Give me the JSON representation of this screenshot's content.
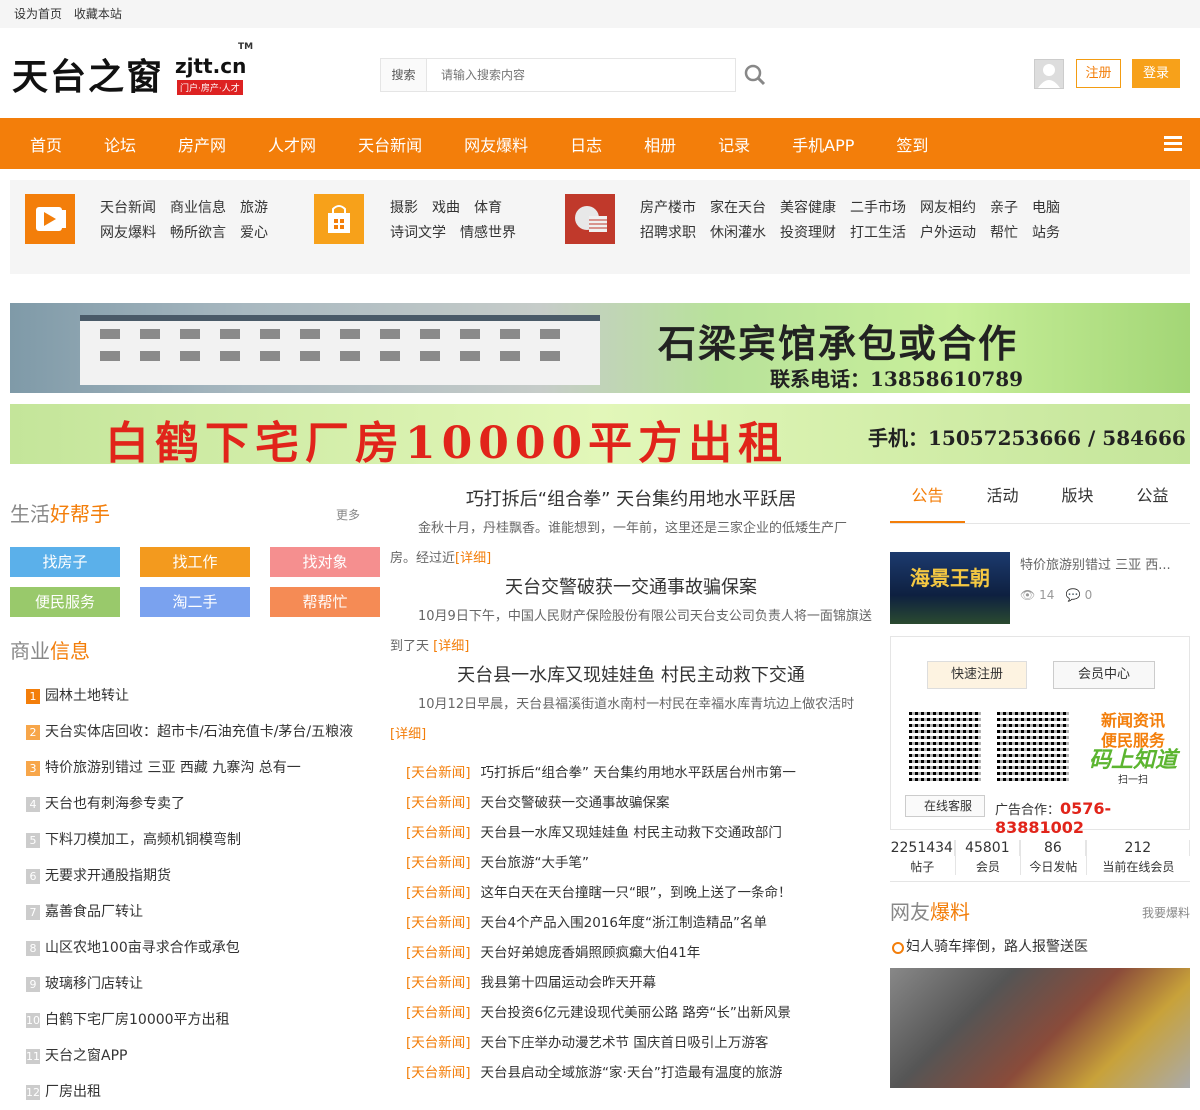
{
  "topbar": {
    "set_home": "设为首页",
    "favorite": "收藏本站"
  },
  "logo": {
    "cn": "天台之窗",
    "domain": "zjtt.cn",
    "tm": "TM",
    "sub": "门户·房产·人才"
  },
  "search": {
    "label": "搜索",
    "placeholder": "请输入搜索内容"
  },
  "auth": {
    "register": "注册",
    "login": "登录"
  },
  "nav": [
    "首页",
    "论坛",
    "房产网",
    "人才网",
    "天台新闻",
    "网友爆料",
    "日志",
    "相册",
    "记录",
    "手机APP",
    "签到"
  ],
  "cats": {
    "group1": {
      "row1": [
        "天台新闻",
        "商业信息",
        "旅游"
      ],
      "row2": [
        "网友爆料",
        "畅所欲言",
        "爱心"
      ]
    },
    "group2": {
      "row1": [
        "摄影",
        "戏曲",
        "体育"
      ],
      "row2": [
        "诗词文学",
        "情感世界"
      ]
    },
    "group3": {
      "row1": [
        "房产楼市",
        "家在天台",
        "美容健康",
        "二手市场",
        "网友相约",
        "亲子",
        "电脑"
      ],
      "row2": [
        "招聘求职",
        "休闲灌水",
        "投资理财",
        "打工生活",
        "户外运动",
        "帮忙",
        "站务"
      ]
    }
  },
  "banners": {
    "b1_title": "石梁宾馆承包或合作",
    "b1_phone": "联系电话：13858610789",
    "b2_title": "白鹤下宅厂房10000平方出租",
    "b2_phone": "手机：15057253666 / 584666"
  },
  "left": {
    "helper_title_a": "生活",
    "helper_title_b": "好帮手",
    "more": "更多",
    "helpers": [
      {
        "label": "找房子",
        "color": "#5bb0ea"
      },
      {
        "label": "找工作",
        "color": "#f39a1e"
      },
      {
        "label": "找对象",
        "color": "#f58f8f"
      },
      {
        "label": "便民服务",
        "color": "#99c96b"
      },
      {
        "label": "淘二手",
        "color": "#7aa2ef"
      },
      {
        "label": "帮帮忙",
        "color": "#f58b55"
      }
    ],
    "biz_title_a": "商业",
    "biz_title_b": "信息",
    "biz": [
      "园林土地转让",
      "天台实体店回收：超市卡/石油充值卡/茅台/五粮液",
      "特价旅游别错过 三亚 西藏 九寨沟 总有一",
      "天台也有刺海参专卖了",
      "下料刀模加工，高频机铜模弯制",
      "无要求开通股指期货",
      "嘉善食品厂转让",
      "山区农地100亩寻求合作或承包",
      "玻璃移门店转让",
      "白鹤下宅厂房10000平方出租",
      "天台之窗APP",
      "厂房出租"
    ],
    "biz_nums": [
      "1",
      "2",
      "3",
      "4",
      "5",
      "6",
      "7",
      "8",
      "9",
      "10",
      "11",
      "12"
    ]
  },
  "mid": {
    "stories": [
      {
        "title": "巧打拆后“组合拳” 天台集约用地水平跃居",
        "body": "金秋十月，丹桂飘香。谁能想到，一年前，这里还是三家企业的低矮生产厂房。经过近",
        "detail": "[详细]"
      },
      {
        "title": "天台交警破获一交通事故骗保案",
        "body": "10月9日下午，中国人民财产保险股份有限公司天台支公司负责人将一面锦旗送到了天",
        "detail": "[详细]"
      },
      {
        "title": "天台县一水库又现娃娃鱼 村民主动救下交通",
        "body": "10月12日早晨，天台县福溪街道水南村一村民在幸福水库青坑边上做农活时",
        "detail": "[详细]"
      }
    ],
    "news_tag": "[天台新闻]",
    "news": [
      "巧打拆后“组合拳” 天台集约用地水平跃居台州市第一",
      "天台交警破获一交通事故骗保案",
      "天台县一水库又现娃娃鱼 村民主动救下交通政部门",
      "天台旅游“大手笔”",
      "这年白天在天台撞瞎一只“眼”，到晚上送了一条命！",
      "天台4个产品入围2016年度“浙江制造精品”名单",
      "天台好弟媳庞香娟照顾疯癫大伯41年",
      "我县第十四届运动会昨天开幕",
      "天台投资6亿元建设现代美丽公路 路旁“长”出新风景",
      "天台下庄举办动漫艺术节 国庆首日吸引上万游客",
      "天台县启动全域旅游“家·天台”打造最有温度的旅游"
    ]
  },
  "right": {
    "tabs": [
      "公告",
      "活动",
      "版块",
      "公益"
    ],
    "ann_img_text": "海景王朝",
    "ann_title": "特价旅游别错过 三亚 西...",
    "ann_views": "14",
    "ann_comments": "0",
    "quick_reg": "快速注册",
    "member": "会员中心",
    "slogan1": "新闻资讯",
    "slogan2": "便民服务",
    "slogan3": "码上知道",
    "slogan_scan": "扫一扫",
    "kf": "在线客服",
    "ad_label": "广告合作：",
    "ad_phone": "0576-83881002",
    "stats": [
      {
        "v": "2251434",
        "l": "帖子"
      },
      {
        "v": "45801",
        "l": "会员"
      },
      {
        "v": "86",
        "l": "今日发帖"
      },
      {
        "v": "212",
        "l": "当前在线会员"
      }
    ],
    "bl_title_a": "网友",
    "bl_title_b": "爆料",
    "bl_more": "我要爆料",
    "bl_item": "妇人骑车摔倒，路人报警送医"
  }
}
